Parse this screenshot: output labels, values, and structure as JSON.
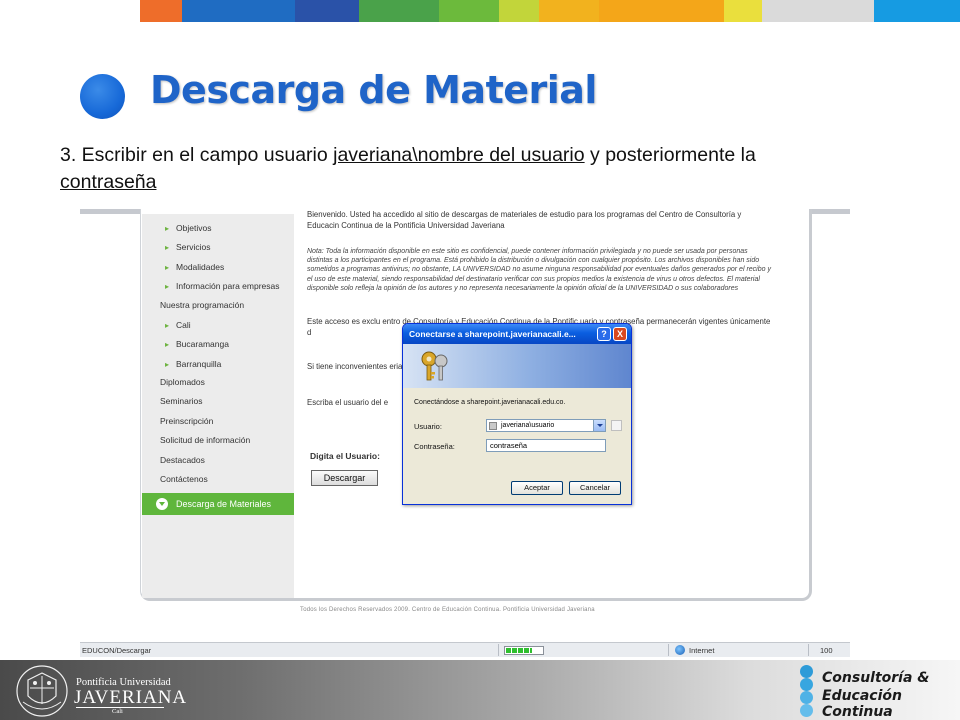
{
  "stripe_colors": [
    "#ffffff",
    "#ee6d2a",
    "#1f6cc2",
    "#2a52a8",
    "#4aa24a",
    "#6cba3c",
    "#c2d53a",
    "#f2b21e",
    "#f4a619",
    "#eadf3d",
    "#dadada",
    "#169be2"
  ],
  "slide": {
    "title": "Descarga de Material",
    "instruction_prefix": "3. Escribir en el campo usuario ",
    "instruction_link1": "javeriana\\nombre del usuario",
    "instruction_mid": " y posteriormente la ",
    "instruction_link2": "contraseña"
  },
  "browser": {
    "sidebar": {
      "items": [
        {
          "label": "Objetivos"
        },
        {
          "label": "Servicios"
        },
        {
          "label": "Modalidades"
        },
        {
          "label": "Información para empresas"
        },
        {
          "label": "Nuestra programación"
        },
        {
          "label": "Cali"
        },
        {
          "label": "Bucaramanga"
        },
        {
          "label": "Barranquilla"
        },
        {
          "label": "Diplomados"
        },
        {
          "label": "Seminarios"
        },
        {
          "label": "Preinscripción"
        },
        {
          "label": "Solicitud de información"
        },
        {
          "label": "Destacados"
        },
        {
          "label": "Contáctenos"
        }
      ],
      "active_label": "Descarga de Materiales"
    },
    "content": {
      "welcome": "Bienvenido. Usted ha accedido al sitio de descargas de materiales de estudio para los programas del Centro de Consultoría y Educacin Continua de la Pontificia Universidad Javeriana",
      "note": "Nota: Toda la información disponible en este sitio es confidencial, puede contener información privilegiada y no puede ser usada por personas distintas a los participantes en el programa. Está prohibido la distribución o divulgación con cualquier propósito. Los archivos disponibles han sido sometidos a programas antivirus; no obstante, LA UNIVERSIDAD no asume ninguna responsabilidad por eventuales daños generados por el recibo y el uso de este material, siendo responsabilidad del destinatario verificar con sus propios medios la existencia de virus u otros defectos. El material disponible solo refleja la opinión de los autores y no representa necesariamente la opinión oficial de la UNIVERSIDAD o sus colaboradores",
      "access": "Este acceso es exclu                                              entro de Consultoría y Educación Continua de la Pontific                                              uario y contraseña permanecerán vigentes únicamente d",
      "problems": "Si tiene inconvenientes                                              erianacali.edu.co o al coordinador académico del program",
      "write": "Escriba el usuario del e",
      "user_label": "Digita el Usuario:",
      "download_button": "Descargar"
    },
    "footer": "Todos los Derechos Reservados 2009. Centro de Educación Continua. Pontificia Universidad Javeriana",
    "status": {
      "url": "EDUCON/Descargar",
      "zone": "Internet",
      "zoom": "100",
      "progress": 0.7
    },
    "dialog": {
      "title": "Conectarse a sharepoint.javerianacali.e...",
      "help_label": "?",
      "close_label": "X",
      "connecting_text": "Conectándose a sharepoint.javerianacali.edu.co.",
      "user_label": "Usuario:",
      "user_value": "javeriana\\usuario",
      "password_label": "Contraseña:",
      "password_value": "contraseña",
      "accept_button": "Aceptar",
      "cancel_button": "Cancelar"
    }
  },
  "branding": {
    "university_top": "Pontificia Universidad",
    "university_name": "JAVERIANA",
    "university_city": "Cali",
    "consultoria_line1": "Consultoría &",
    "consultoria_line2": "Educación Continua"
  }
}
